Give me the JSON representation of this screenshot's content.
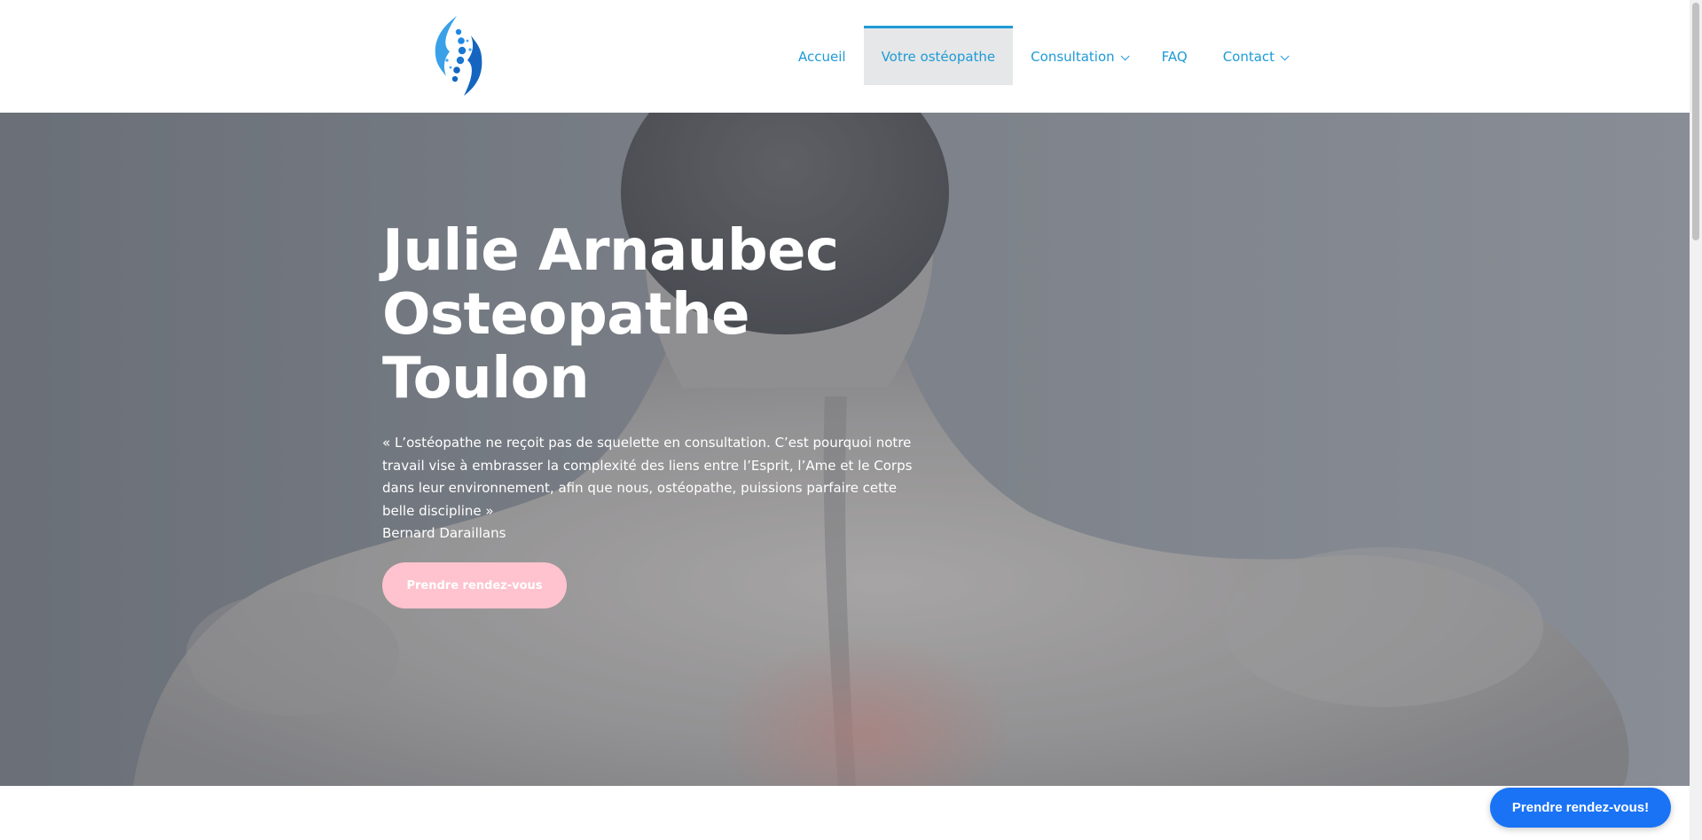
{
  "logo": {
    "icon": "spine-hands-logo-icon",
    "colors": [
      "#3aa0e8",
      "#1565c0"
    ]
  },
  "nav": {
    "items": [
      {
        "label": "Accueil",
        "active": false,
        "dropdown": false
      },
      {
        "label": "Votre ostéopathe",
        "active": true,
        "dropdown": false
      },
      {
        "label": "Consultation",
        "active": false,
        "dropdown": true
      },
      {
        "label": "FAQ",
        "active": false,
        "dropdown": false
      },
      {
        "label": "Contact",
        "active": false,
        "dropdown": true
      }
    ],
    "color": "#1e9ad6",
    "active_background": "#e6e7e8"
  },
  "hero": {
    "title_lines": [
      "Julie Arnaubec",
      "Osteopathe",
      "Toulon"
    ],
    "quote": "« L’ostéopathe ne reçoit pas de squelette en consultation. C’est pourquoi notre travail vise à embrasser la complexité des liens entre l’Esprit, l’Ame et le Corps dans leur environnement, afin que nous, ostéopathe, puissions parfaire cette belle discipline »",
    "author": "Bernard Daraillans",
    "cta_label": "Prendre rendez-vous",
    "cta_color": "#fec3ce",
    "background_image": "man-back-pain-photo"
  },
  "floating_button": {
    "label": "Prendre rendez-vous!",
    "color": "#1a73f5"
  }
}
